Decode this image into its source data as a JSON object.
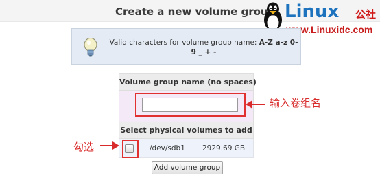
{
  "page": {
    "title": "Create a new volume group"
  },
  "watermark": {
    "brand": "Linux",
    "brand_cn": "公社",
    "url": "www.Linuxidc.com"
  },
  "info": {
    "text_prefix": "Valid characters for volume group name: ",
    "allowed_chars": "A-Z a-z 0-9 _ + -"
  },
  "form": {
    "name_header": "Volume group name (no spaces)",
    "name_value": "",
    "physical_header": "Select physical volumes to add",
    "volumes": [
      {
        "checked": false,
        "device": "/dev/sdb1",
        "size": "2929.69 GB"
      }
    ],
    "submit_label": "Add volume group"
  },
  "annotations": {
    "input_note": "输入卷组名",
    "check_note": "勾选",
    "color": "#d92b2b"
  },
  "colors": {
    "highlight": "#e03030",
    "info_bg": "#e4ebf4",
    "input_row_bg": "#f3e9f7",
    "volume_row_bg": "#eef3fb"
  }
}
